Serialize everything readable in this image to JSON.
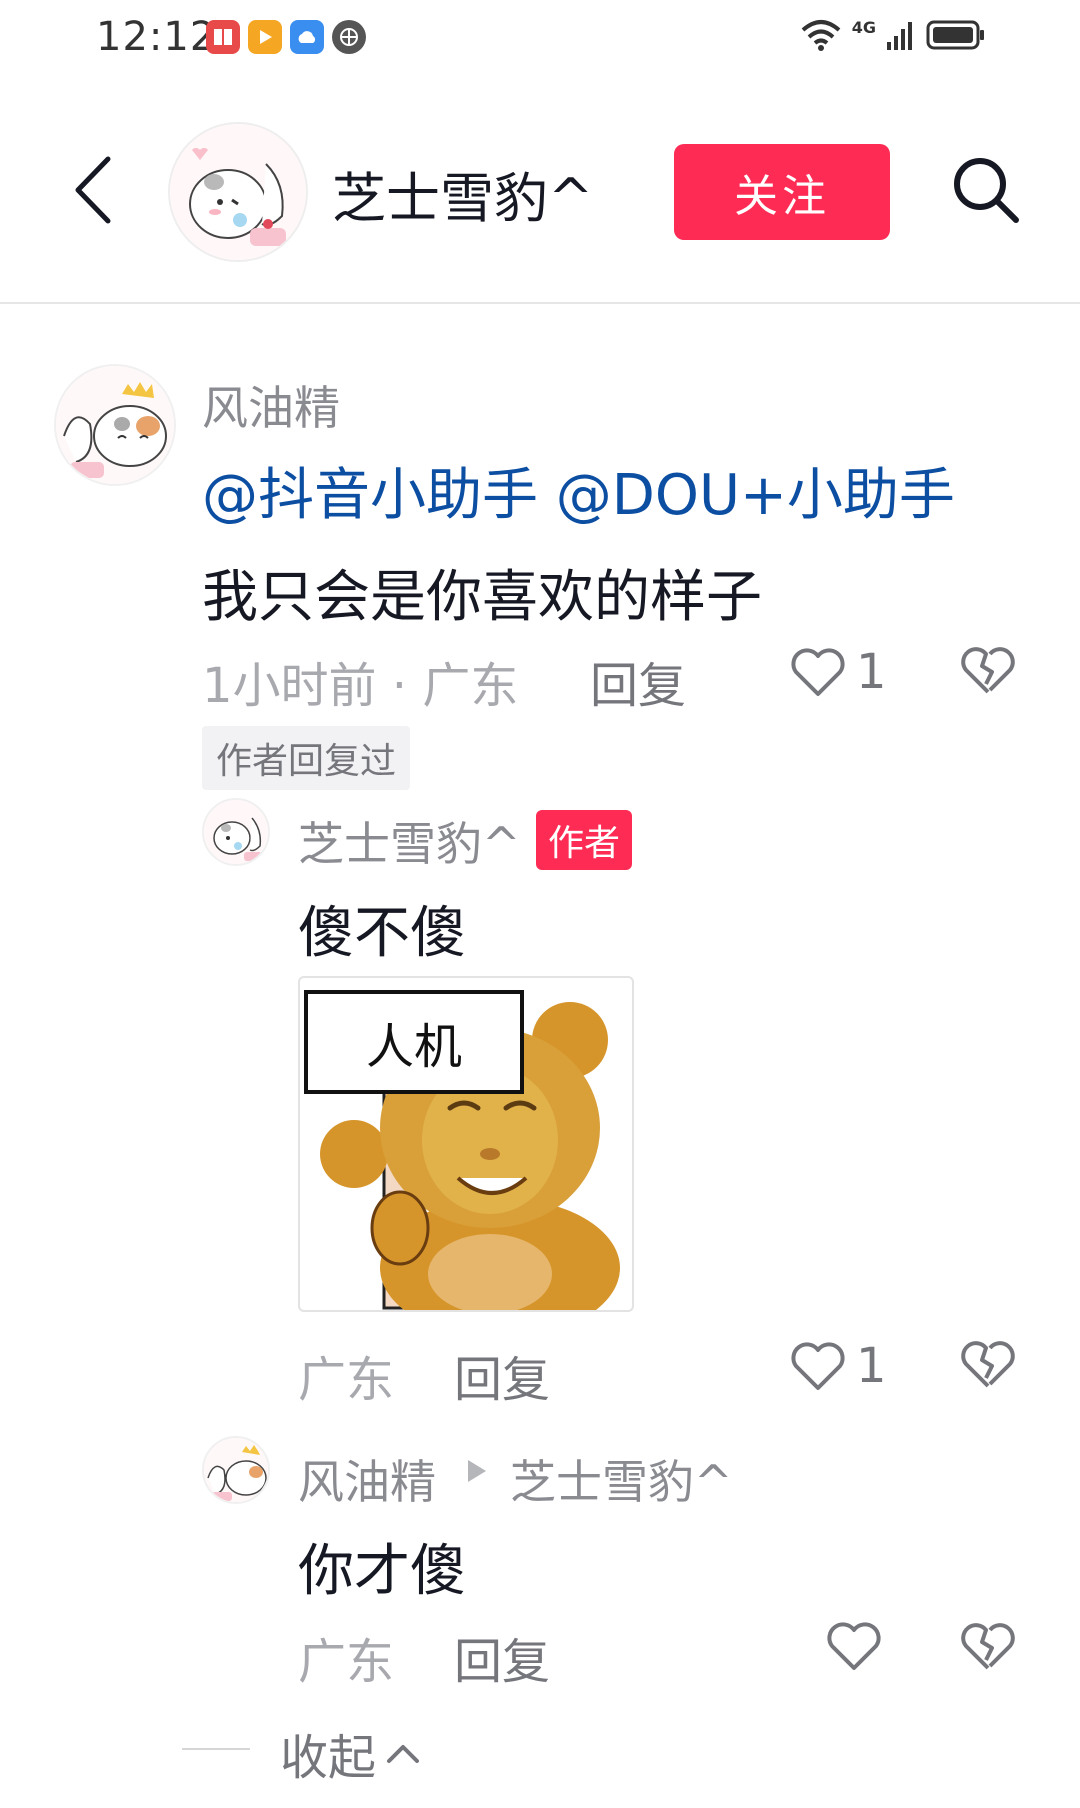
{
  "status_bar": {
    "time": "12:12",
    "network": "4G"
  },
  "header": {
    "title": "芝士雪豹^",
    "follow_label": "关注"
  },
  "comment": {
    "author": "风油精",
    "mentions": "@抖音小助手 @DOU+小助手",
    "text": "我只会是你喜欢的样子",
    "time_location": "1小时前 · 广东",
    "reply_label": "回复",
    "likes": "1",
    "author_replied_badge": "作者回复过"
  },
  "replies": [
    {
      "author": "芝士雪豹^",
      "tag": "作者",
      "text": "傻不傻",
      "sticker_text": "人机",
      "location": "广东",
      "reply_label": "回复",
      "likes": "1"
    },
    {
      "author": "风油精",
      "reply_to": "芝士雪豹^",
      "text": "你才傻",
      "location": "广东",
      "reply_label": "回复"
    }
  ],
  "collapse_label": "收起",
  "colors": {
    "accent": "#fe2c55",
    "mention": "#0b4ea2",
    "muted": "#a8a9ae"
  }
}
